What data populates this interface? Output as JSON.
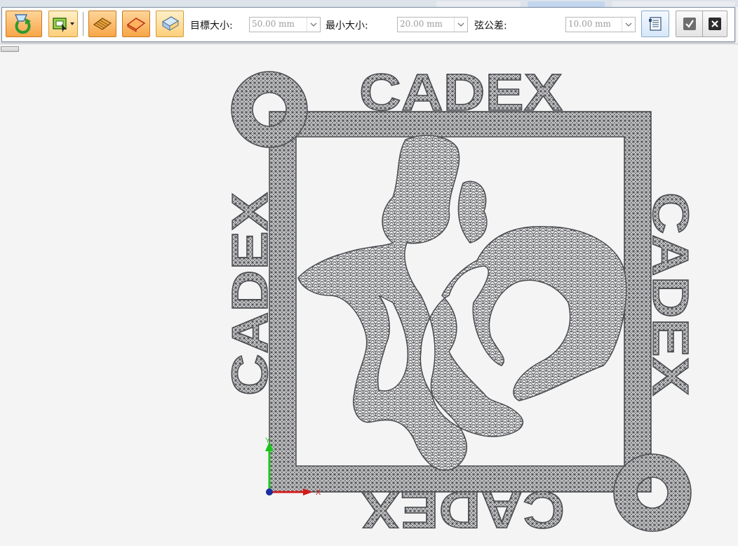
{
  "toolbar": {
    "target_size_label": "目標大小:",
    "target_size_value": "50.00 mm",
    "min_size_label": "最小大小:",
    "min_size_value": "20.00 mm",
    "chord_tolerance_label": "弦公差:",
    "chord_tolerance_value": "10.00 mm",
    "buttons": [
      {
        "icon": "remesh-update-icon"
      },
      {
        "icon": "select-region-icon"
      },
      {
        "icon": "surface-mesh-icon"
      },
      {
        "icon": "solid-mesh-icon"
      },
      {
        "icon": "shell-mesh-icon"
      },
      {
        "icon": "mesh-options-icon"
      },
      {
        "icon": "accept-check-icon"
      },
      {
        "icon": "cancel-x-icon"
      }
    ]
  },
  "viewport": {
    "model_text": "CADEX",
    "triad": {
      "y_label": "Y",
      "x_label": "X"
    },
    "colors": {
      "mesh": "#4a4c50",
      "background": "#f4f4f4",
      "axis_y": "#1ec41e",
      "axis_x": "#d11a1a",
      "origin": "#1a2f9e"
    }
  }
}
